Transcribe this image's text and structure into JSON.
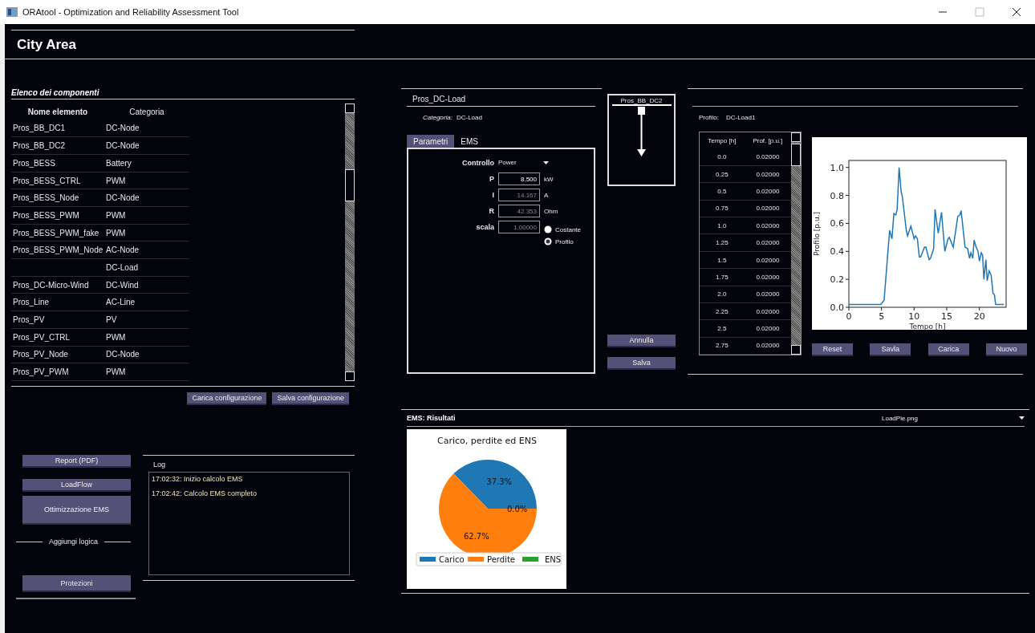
{
  "window": {
    "title": "ORAtool - Optimization and Reliability Assessment Tool"
  },
  "header": {
    "title": "City Area"
  },
  "components": {
    "title": "Elenco dei componenti",
    "columns": [
      "Nome elemento",
      "Categoria"
    ],
    "rows": [
      {
        "name": "Pros_BB_DC1",
        "category": "DC-Node"
      },
      {
        "name": "Pros_BB_DC2",
        "category": "DC-Node"
      },
      {
        "name": "Pros_BESS",
        "category": "Battery"
      },
      {
        "name": "Pros_BESS_CTRL",
        "category": "PWM"
      },
      {
        "name": "Pros_BESS_Node",
        "category": "DC-Node"
      },
      {
        "name": "Pros_BESS_PWM",
        "category": "PWM"
      },
      {
        "name": "Pros_BESS_PWM_fake",
        "category": "PWM"
      },
      {
        "name": "Pros_BESS_PWM_Node",
        "category": "AC-Node"
      },
      {
        "category": "DC-Load"
      },
      {
        "name": "Pros_DC-Micro-Wind",
        "category": "DC-Wind"
      },
      {
        "name": "Pros_Line",
        "category": "AC-Line"
      },
      {
        "name": "Pros_PV",
        "category": "PV"
      },
      {
        "name": "Pros_PV_CTRL",
        "category": "PWM"
      },
      {
        "name": "Pros_PV_Node",
        "category": "DC-Node"
      },
      {
        "name": "Pros_PV_PWM",
        "category": "PWM"
      }
    ],
    "buttons": [
      "Carica configurazione",
      "Salva configurazione"
    ]
  },
  "actions": [
    {
      "kind": "button",
      "label": "Report (PDF)"
    },
    {
      "kind": "button",
      "label": "LoadFlow"
    },
    {
      "kind": "button",
      "label": "Ottimizzazione EMS"
    },
    {
      "kind": "divider",
      "label": "Aggiungi logica"
    },
    {
      "kind": "button",
      "label": "Protezioni"
    }
  ],
  "log": {
    "title": "Log",
    "entries": [
      "17:02:32: Inizio calcolo EMS",
      "17:02:42: Calcolo EMS completo"
    ]
  },
  "element": {
    "name": "Pros_DC-Load",
    "category_label": "Categoria:",
    "category": "DC-Load",
    "tabs": [
      {
        "label": "Parametri",
        "selected": true
      },
      {
        "label": "EMS",
        "selected": false
      }
    ],
    "fields": [
      {
        "kind": "combo",
        "label": "Controllo",
        "value": "Power"
      },
      {
        "kind": "input",
        "label": "P",
        "value": "8.500",
        "unit": "kW",
        "disabled": false
      },
      {
        "kind": "input",
        "label": "I",
        "value": "14.167",
        "unit": "A",
        "disabled": true
      },
      {
        "kind": "input",
        "label": "R",
        "value": "42.353",
        "unit": "Ohm",
        "disabled": true
      },
      {
        "kind": "input",
        "label": "scala",
        "value": "1.00000",
        "disabled": true
      }
    ],
    "modes": [
      {
        "label": "Costante",
        "selected": false
      },
      {
        "label": "Profilo",
        "selected": true
      }
    ],
    "bus": "Pros_BB_DC2",
    "buttons": [
      "Annulla",
      "Salva"
    ]
  },
  "profile": {
    "label": "Profilo:",
    "name": "DC-Load1",
    "columns": [
      "Tempo [h]",
      "Prof. [p.u.]"
    ],
    "rows": [
      [
        "0.0",
        "0.02000"
      ],
      [
        "0.25",
        "0.02000"
      ],
      [
        "0.5",
        "0.02000"
      ],
      [
        "0.75",
        "0.02000"
      ],
      [
        "1.0",
        "0.02000"
      ],
      [
        "1.25",
        "0.02000"
      ],
      [
        "1.5",
        "0.02000"
      ],
      [
        "1.75",
        "0.02000"
      ],
      [
        "2.0",
        "0.02000"
      ],
      [
        "2.25",
        "0.02000"
      ],
      [
        "2.5",
        "0.02000"
      ],
      [
        "2.75",
        "0.02000"
      ]
    ],
    "chart_data": {
      "type": "line",
      "xlabel": "Tempo [h]",
      "ylabel": "Profilo [p.u.]",
      "x": [
        0,
        4.9,
        5.4,
        6.25,
        6.6,
        6.9,
        7.2,
        7.4,
        7.7,
        8.0,
        8.2,
        8.8,
        9.0,
        9.5,
        10.0,
        10.2,
        10.5,
        10.8,
        11.0,
        11.6,
        11.8,
        12.3,
        12.5,
        13.0,
        13.2,
        13.7,
        14.2,
        14.7,
        15.2,
        15.4,
        16.0,
        16.7,
        17.0,
        17.2,
        17.8,
        18.2,
        18.5,
        18.7,
        19.0,
        19.2,
        19.5,
        19.8,
        20.0,
        20.3,
        20.5,
        20.7,
        21.0,
        21.2,
        21.5,
        21.8,
        22.1,
        22.3,
        22.5,
        23.75
      ],
      "series": [
        {
          "color": "#1f77b4",
          "values": [
            0.02,
            0.02,
            0.05,
            0.55,
            0.49,
            0.67,
            0.66,
            0.7,
            1.0,
            0.83,
            0.79,
            0.55,
            0.51,
            0.58,
            0.49,
            0.51,
            0.49,
            0.36,
            0.36,
            0.43,
            0.43,
            0.34,
            0.35,
            0.42,
            0.7,
            0.53,
            0.68,
            0.4,
            0.49,
            0.5,
            0.43,
            0.65,
            0.66,
            0.69,
            0.43,
            0.42,
            0.35,
            0.39,
            0.35,
            0.48,
            0.43,
            0.4,
            0.33,
            0.39,
            0.37,
            0.2,
            0.34,
            0.19,
            0.26,
            0.23,
            0.1,
            0.09,
            0.02,
            0.02
          ]
        }
      ],
      "xlim": [
        0,
        24.1
      ],
      "ylim": [
        0,
        1.05
      ],
      "xticks": [
        0,
        5,
        10,
        15,
        20
      ],
      "yticks": [
        {
          "value": 0,
          "label": "0.0"
        },
        {
          "value": 0.2,
          "label": "0.2"
        },
        {
          "value": 0.4,
          "label": "0.4"
        },
        {
          "value": 0.6,
          "label": "0.6"
        },
        {
          "value": 0.8,
          "label": "0.8"
        },
        {
          "value": 1.0,
          "label": "1.0"
        }
      ]
    },
    "buttons": [
      "Reset",
      "Savla",
      "Carica",
      "Nuovo"
    ]
  },
  "results": {
    "title": "EMS: Risultati",
    "selector": "LoadPie.png",
    "chart_data": {
      "type": "pie",
      "title": "Carico, perdite ed ENS",
      "categories": [
        "Carico",
        "Perdite",
        "ENS"
      ],
      "values": [
        37.3,
        62.7,
        0.0
      ],
      "colors": [
        "#1f77b4",
        "#ff7f0e",
        "#2ca02c"
      ],
      "legend": "lower center",
      "value_labels": [
        "37.3%",
        "62.7%",
        "0.0%"
      ]
    }
  }
}
